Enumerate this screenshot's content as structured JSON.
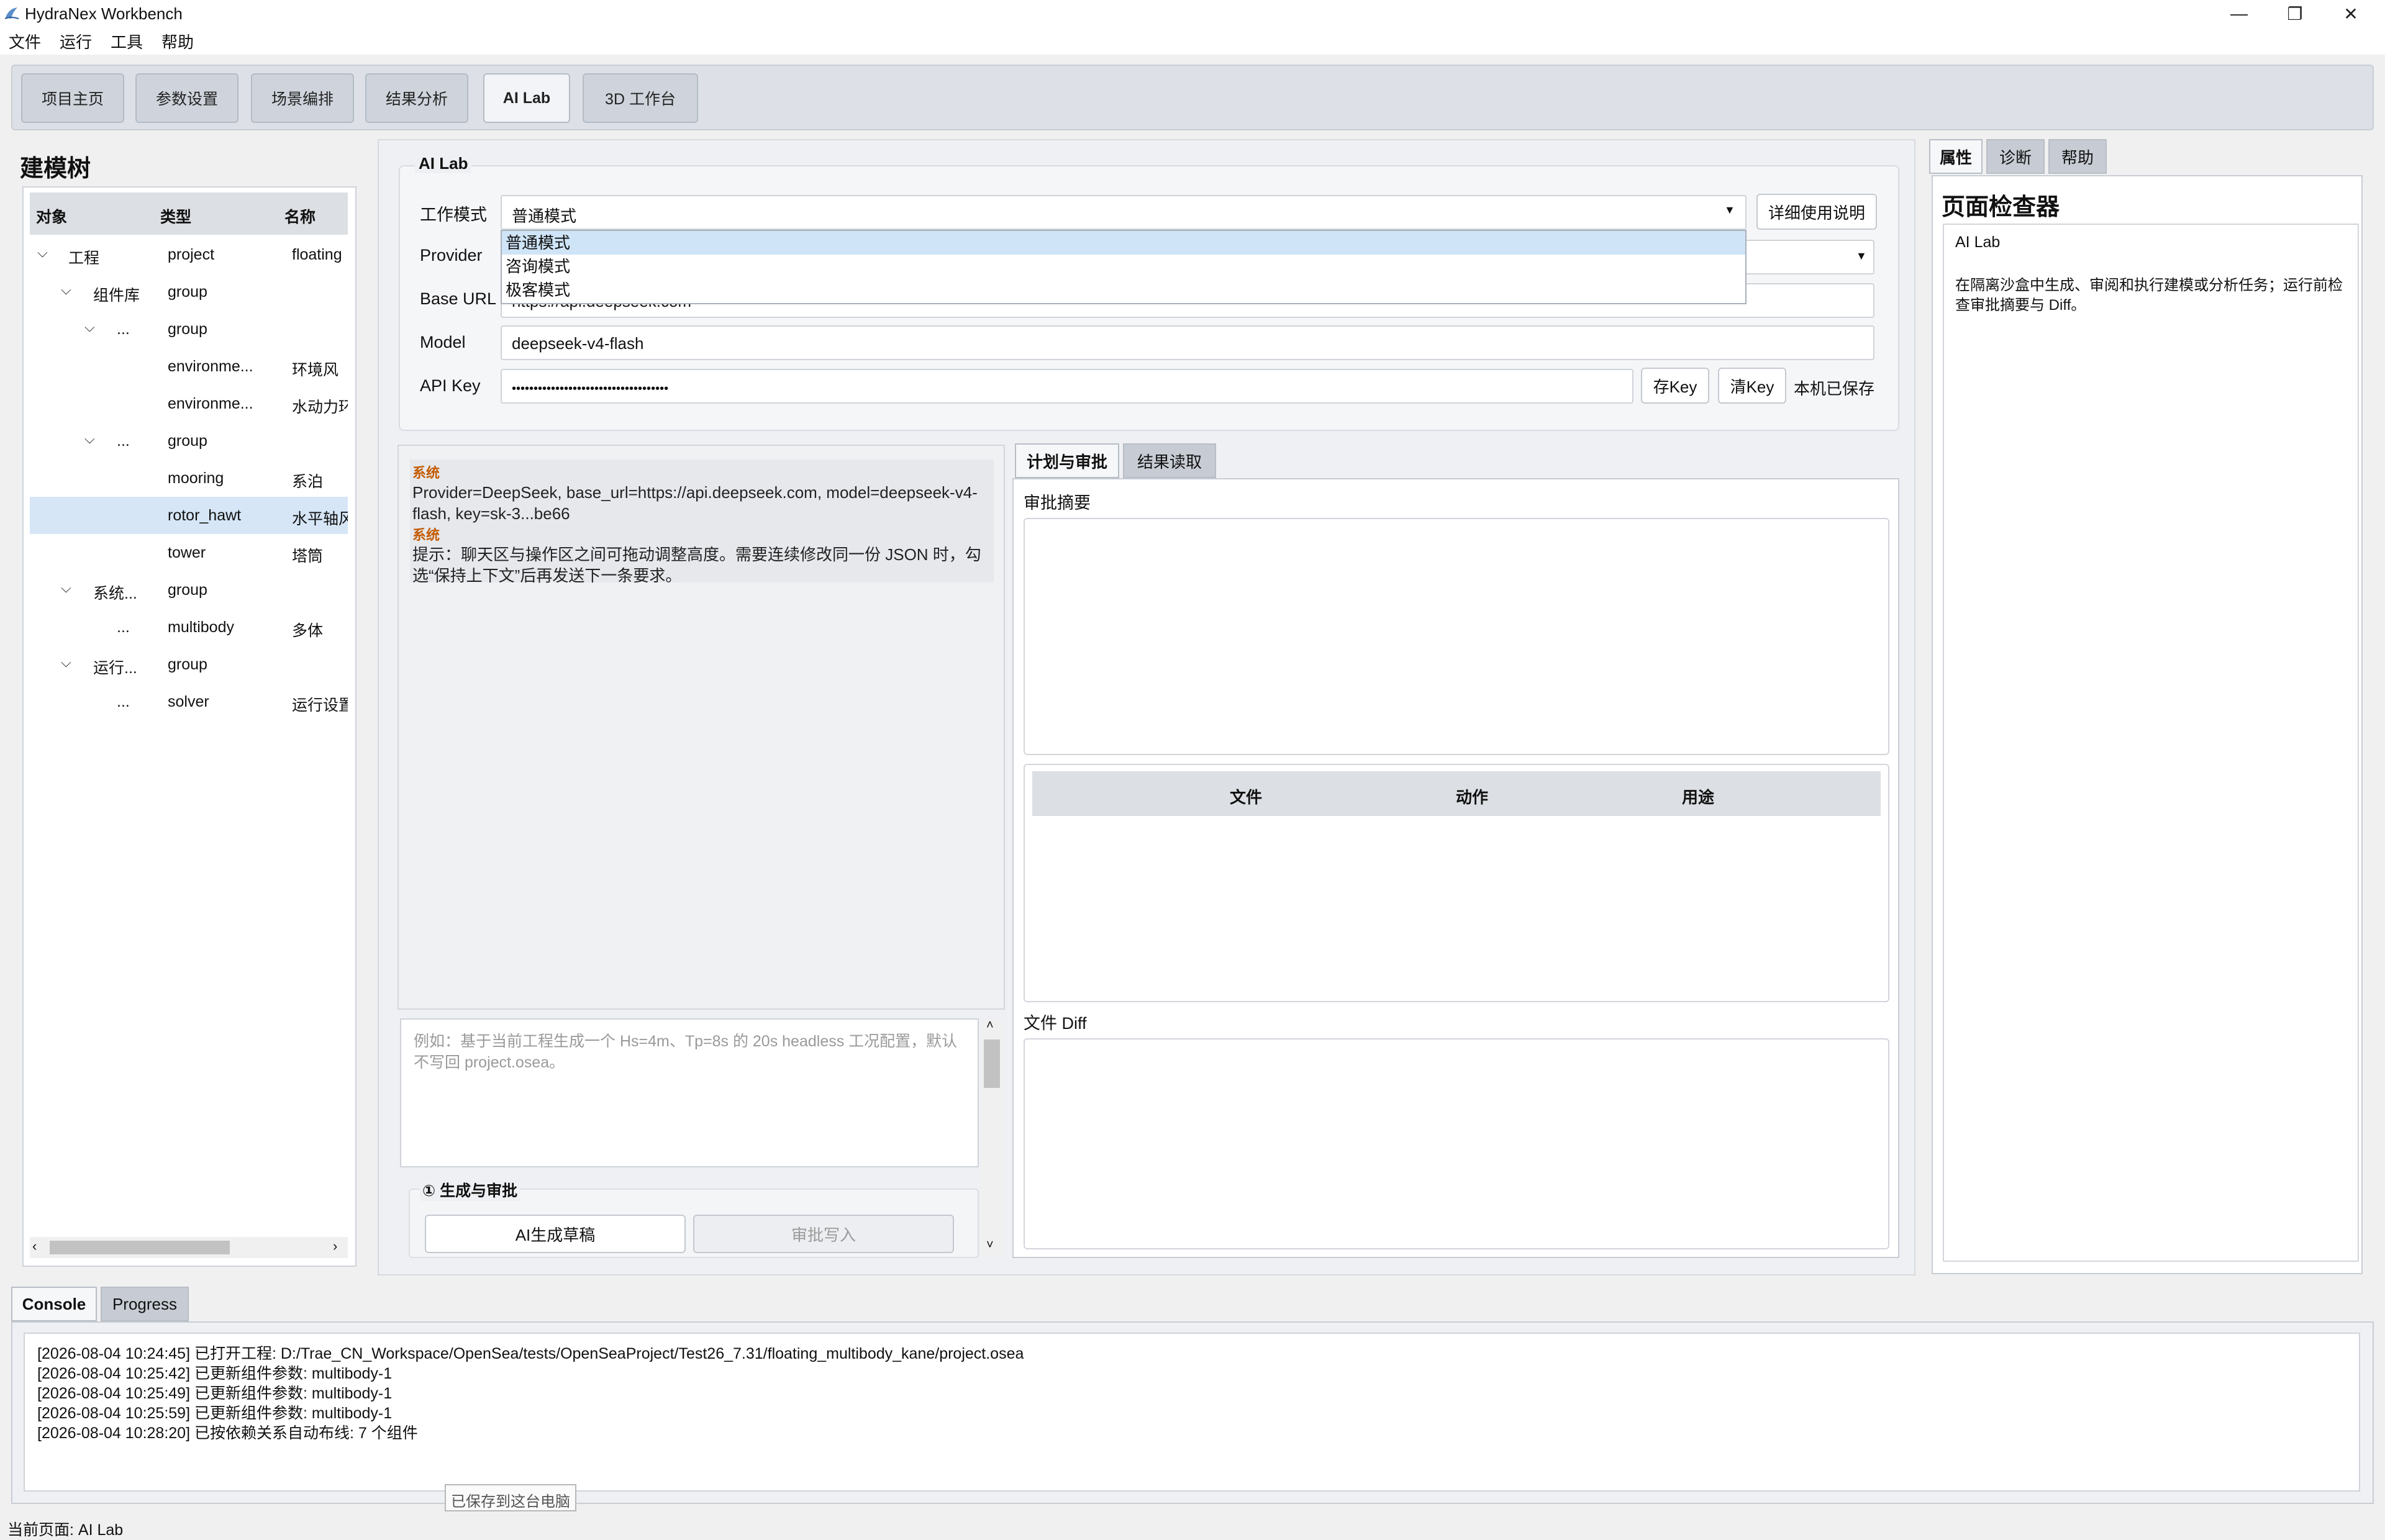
{
  "window": {
    "title": "HydraNex Workbench",
    "minimize_glyph": "—",
    "maximize_glyph": "❐",
    "close_glyph": "✕"
  },
  "menu": [
    "文件",
    "运行",
    "工具",
    "帮助"
  ],
  "nav_tabs": [
    "项目主页",
    "参数设置",
    "场景编排",
    "结果分析",
    "AI Lab",
    "3D 工作台"
  ],
  "active_nav_tab": "AI Lab",
  "tree": {
    "title": "建模树",
    "headers": [
      "对象",
      "类型",
      "名称"
    ],
    "rows": [
      {
        "object": "工程",
        "type": "project",
        "name": "floating"
      },
      {
        "object": "组件库",
        "type": "group",
        "name": ""
      },
      {
        "object": "...",
        "type": "group",
        "name": ""
      },
      {
        "object": "environme...",
        "type": "",
        "name": "环境风"
      },
      {
        "object": "environme...",
        "type": "",
        "name": "水动力环"
      },
      {
        "object": "...",
        "type": "group",
        "name": ""
      },
      {
        "object": "mooring",
        "type": "",
        "name": "系泊"
      },
      {
        "object": "rotor_hawt",
        "type": "",
        "name": "水平轴风"
      },
      {
        "object": "tower",
        "type": "",
        "name": "塔筒"
      },
      {
        "object": "系统...",
        "type": "group",
        "name": ""
      },
      {
        "object": "...",
        "type": "multibody",
        "name": "多体"
      },
      {
        "object": "运行...",
        "type": "group",
        "name": ""
      },
      {
        "object": "...",
        "type": "solver",
        "name": "运行设置"
      }
    ],
    "selected_row": "rotor_hawt"
  },
  "ai_lab": {
    "group_title": "AI Lab",
    "mode_label": "工作模式",
    "mode_value": "普通模式",
    "mode_options": [
      "普通模式",
      "咨询模式",
      "极客模式"
    ],
    "help_button": "详细使用说明",
    "provider_label": "Provider",
    "base_url_label": "Base URL",
    "base_url_value": "https://api.deepseek.com",
    "model_label": "Model",
    "model_value": "deepseek-v4-flash",
    "api_key_label": "API Key",
    "api_key_value": "••••••••••••••••••••••••••••••••••••",
    "save_key_button": "存Key",
    "clear_key_button": "清Key",
    "key_status": "本机已保存"
  },
  "chat": {
    "messages": [
      {
        "role": "系统",
        "text": "Provider=DeepSeek, base_url=https://api.deepseek.com, model=deepseek-v4-flash, key=sk-3...be66"
      },
      {
        "role": "系统",
        "text": "提示：聊天区与操作区之间可拖动调整高度。需要连续修改同一份 JSON 时，勾选“保持上下文”后再发送下一条要求。"
      }
    ],
    "input_placeholder": "例如：基于当前工程生成一个 Hs=4m、Tp=8s 的 20s headless 工况配置，默认不写回 project.osea。",
    "step_title": "① 生成与审批",
    "generate_button": "AI生成草稿",
    "approve_button": "审批写入"
  },
  "plan_panel": {
    "tabs": [
      "计划与审批",
      "结果读取"
    ],
    "summary_label": "审批摘要",
    "table_headers": [
      "文件",
      "动作",
      "用途"
    ],
    "diff_label": "文件 Diff"
  },
  "inspector": {
    "tabs": [
      "属性",
      "诊断",
      "帮助"
    ],
    "title": "页面检查器",
    "page_name": "AI Lab",
    "description": "在隔离沙盒中生成、审阅和执行建模或分析任务；运行前检查审批摘要与 Diff。"
  },
  "console": {
    "tabs": [
      "Console",
      "Progress"
    ],
    "lines": [
      "[2026-08-04 10:24:45] 已打开工程: D:/Trae_CN_Workspace/OpenSea/tests/OpenSeaProject/Test26_7.31/floating_multibody_kane/project.osea",
      "[2026-08-04 10:25:42] 已更新组件参数: multibody-1",
      "[2026-08-04 10:25:49] 已更新组件参数: multibody-1",
      "[2026-08-04 10:25:59] 已更新组件参数: multibody-1",
      "[2026-08-04 10:28:20] 已按依赖关系自动布线: 7 个组件"
    ],
    "tooltip": "已保存到这台电脑"
  },
  "status_bar": "当前页面: AI Lab",
  "colors": {
    "accent": "#c45a00",
    "selection": "#d6e6f6",
    "highlight": "#cfe4f7"
  }
}
